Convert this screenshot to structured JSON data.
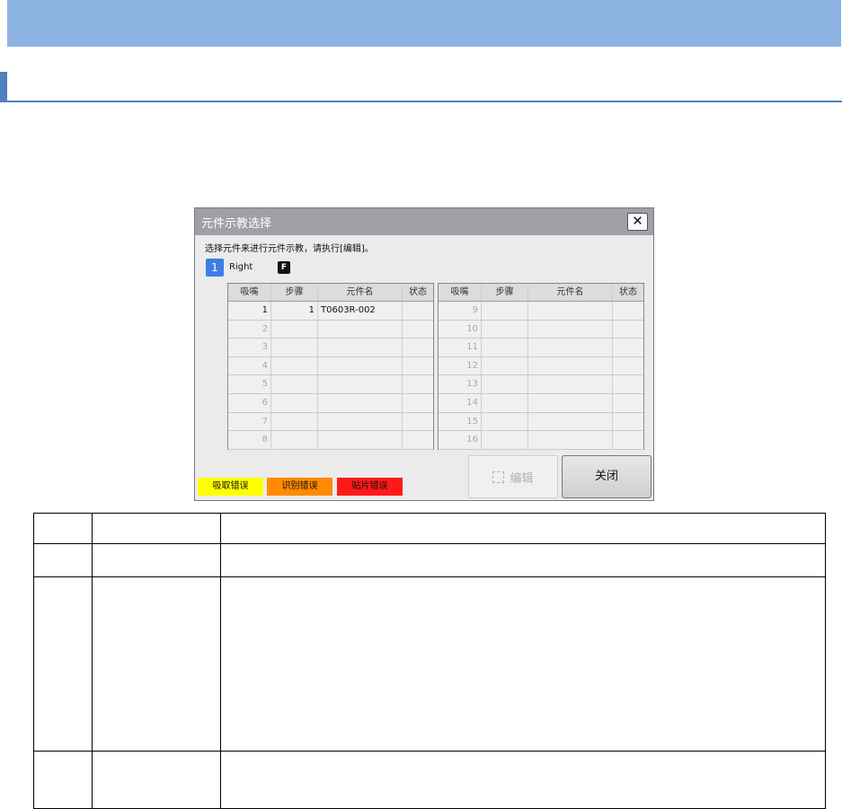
{
  "dialog": {
    "title": "元件示教选择",
    "close_glyph": "✕",
    "instruction": "选择元件来进行元件示教，请执行[编辑]。",
    "head": {
      "number": "1",
      "name": "Right",
      "flag": "F"
    },
    "columns": [
      "吸嘴",
      "步骤",
      "元件名",
      "状态"
    ],
    "left_rows": [
      {
        "nozzle": "1",
        "step": "1",
        "part": "T0603R-002",
        "status": ""
      },
      {
        "nozzle": "2",
        "step": "",
        "part": "",
        "status": ""
      },
      {
        "nozzle": "3",
        "step": "",
        "part": "",
        "status": ""
      },
      {
        "nozzle": "4",
        "step": "",
        "part": "",
        "status": ""
      },
      {
        "nozzle": "5",
        "step": "",
        "part": "",
        "status": ""
      },
      {
        "nozzle": "6",
        "step": "",
        "part": "",
        "status": ""
      },
      {
        "nozzle": "7",
        "step": "",
        "part": "",
        "status": ""
      },
      {
        "nozzle": "8",
        "step": "",
        "part": "",
        "status": ""
      }
    ],
    "right_rows": [
      {
        "nozzle": "9",
        "step": "",
        "part": "",
        "status": ""
      },
      {
        "nozzle": "10",
        "step": "",
        "part": "",
        "status": ""
      },
      {
        "nozzle": "11",
        "step": "",
        "part": "",
        "status": ""
      },
      {
        "nozzle": "12",
        "step": "",
        "part": "",
        "status": ""
      },
      {
        "nozzle": "13",
        "step": "",
        "part": "",
        "status": ""
      },
      {
        "nozzle": "14",
        "step": "",
        "part": "",
        "status": ""
      },
      {
        "nozzle": "15",
        "step": "",
        "part": "",
        "status": ""
      },
      {
        "nozzle": "16",
        "step": "",
        "part": "",
        "status": ""
      }
    ],
    "legend": {
      "pick_error": "吸取错误",
      "vision_error": "识别错误",
      "place_error": "贴片错误"
    },
    "edit_button": "编辑",
    "close_button": "关闭"
  },
  "colors": {
    "banner": "#8db3e2",
    "accent": "#4f81bd",
    "title_bar": "#a09fa7",
    "head_badge": "#3d7ee6",
    "pick_error": "#ffff00",
    "vision_error": "#ff8a00",
    "place_error": "#ff1a1a"
  }
}
